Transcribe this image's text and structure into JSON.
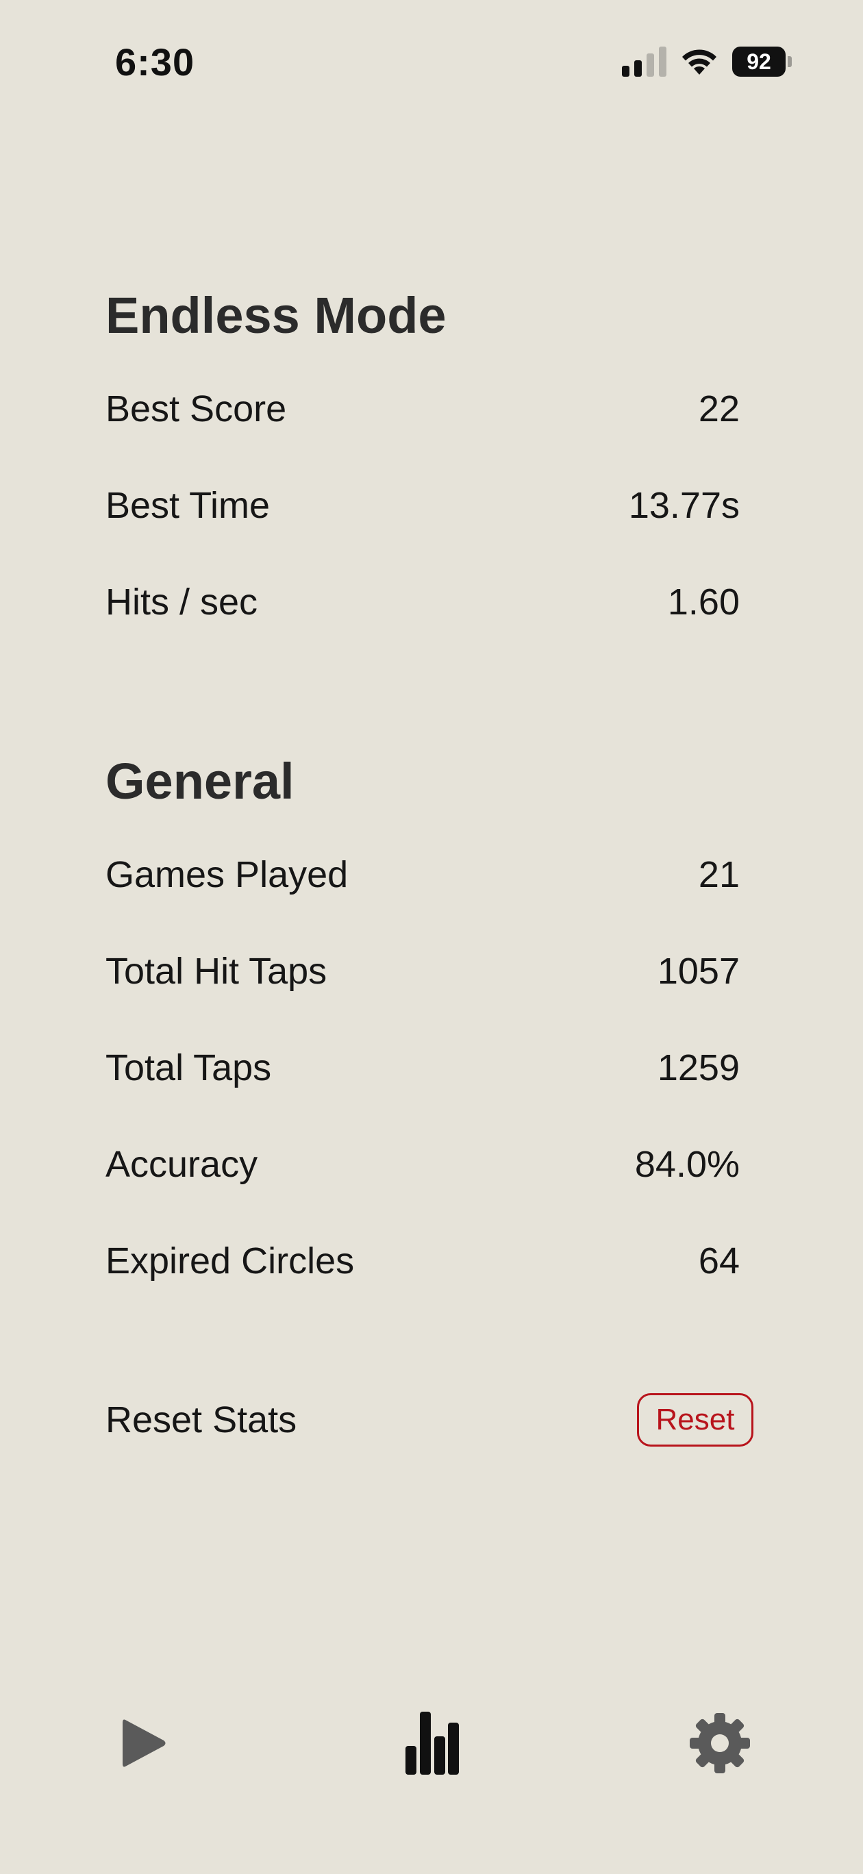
{
  "status_bar": {
    "time": "6:30",
    "battery": "92"
  },
  "endless_mode": {
    "title": "Endless Mode",
    "rows": [
      {
        "label": "Best Score",
        "value": "22"
      },
      {
        "label": "Best Time",
        "value": "13.77s"
      },
      {
        "label": "Hits / sec",
        "value": "1.60"
      }
    ]
  },
  "general": {
    "title": "General",
    "rows": [
      {
        "label": "Games Played",
        "value": "21"
      },
      {
        "label": "Total Hit Taps",
        "value": "1057"
      },
      {
        "label": "Total Taps",
        "value": "1259"
      },
      {
        "label": "Accuracy",
        "value": "84.0%"
      },
      {
        "label": "Expired Circles",
        "value": "64"
      }
    ]
  },
  "reset": {
    "label": "Reset Stats",
    "button_label": "Reset"
  },
  "tab_bar": {
    "tabs": [
      {
        "icon": "play-icon",
        "active": false
      },
      {
        "icon": "bar-chart-icon",
        "active": true
      },
      {
        "icon": "gear-icon",
        "active": false
      }
    ]
  },
  "colors": {
    "background": "#e6e3d9",
    "accent_red": "#b8141c",
    "inactive_icon": "#5a5a5a",
    "active_icon": "#111111"
  }
}
